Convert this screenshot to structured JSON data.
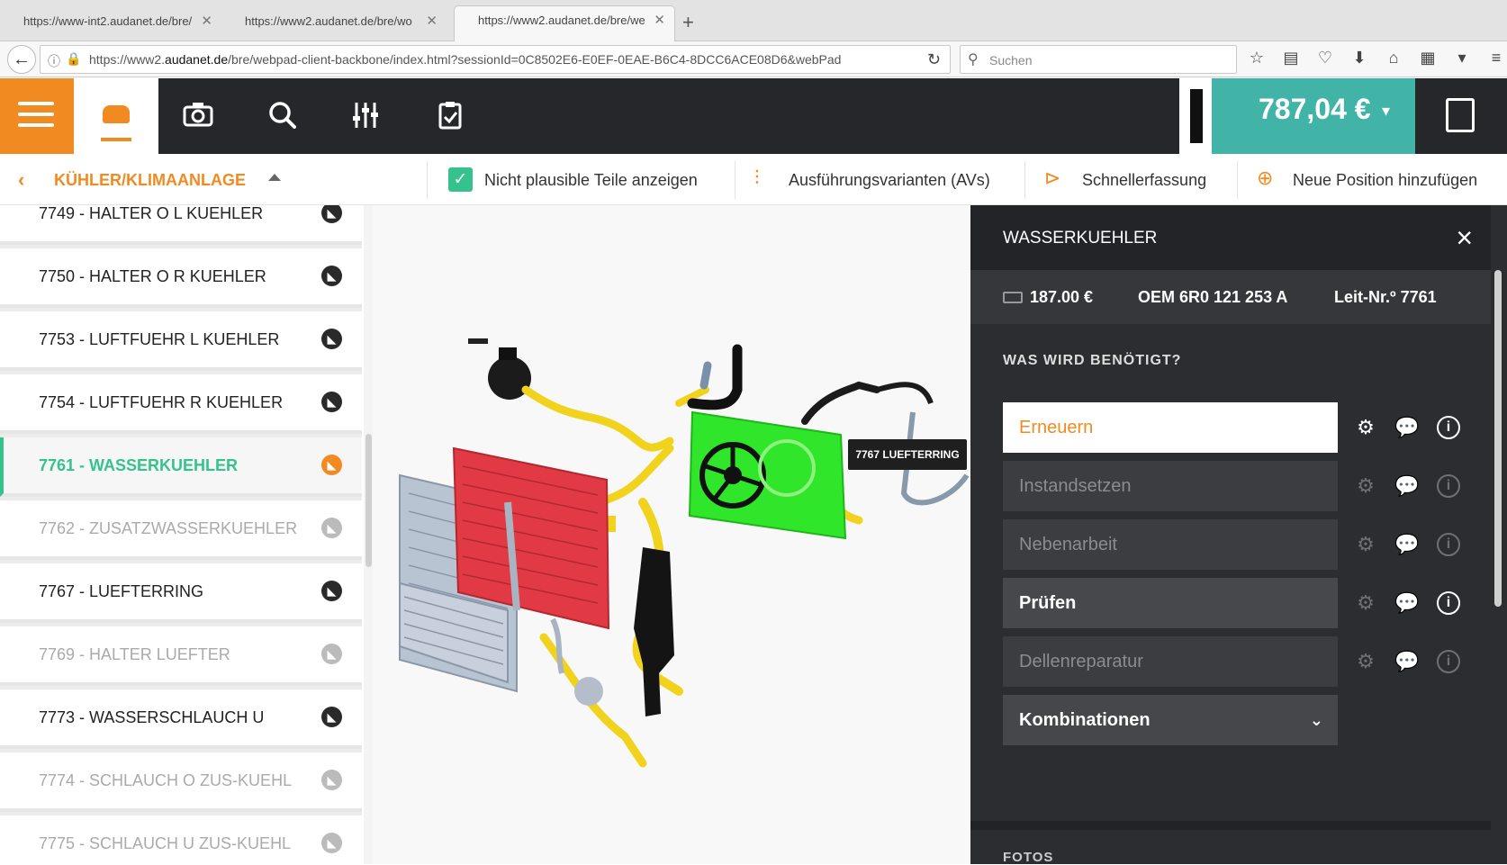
{
  "browser": {
    "tabs": [
      {
        "title": "https://www-int2.audanet.de/bre/"
      },
      {
        "title": "https://www2.audanet.de/bre/wo"
      },
      {
        "title": "https://www2.audanet.de/bre/we"
      }
    ],
    "url_prefix": "https://www2.",
    "url_domain": "audanet.de",
    "url_rest": "/bre/webpad-client-backbone/index.html?sessionId=0C8502E6-E0EF-0EAE-B6C4-8DCC6ACE08D6&webPad",
    "search_placeholder": "Suchen"
  },
  "header": {
    "price": "787,04 €"
  },
  "toolbar": {
    "breadcrumb": "KÜHLER/KLIMAANLAGE",
    "implausible_label": "Nicht plausible Teile anzeigen",
    "variants_label": "Ausführungsvarianten (AVs)",
    "quick_entry_label": "Schnellerfassung",
    "add_position_label": "Neue Position hinzufügen"
  },
  "parts_list": [
    {
      "label": "7749 - HALTER O L KUEHLER",
      "state": "normal"
    },
    {
      "label": "7750 - HALTER O R KUEHLER",
      "state": "normal"
    },
    {
      "label": "7753 - LUFTFUEHR L KUEHLER",
      "state": "normal"
    },
    {
      "label": "7754 - LUFTFUEHR R KUEHLER",
      "state": "normal"
    },
    {
      "label": "7761 - WASSERKUEHLER",
      "state": "active"
    },
    {
      "label": "7762 - ZUSATZWASSERKUEHLER",
      "state": "dim"
    },
    {
      "label": "7767 - LUEFTERRING",
      "state": "normal"
    },
    {
      "label": "7769 - HALTER LUEFTER",
      "state": "dim"
    },
    {
      "label": "7773 - WASSERSCHLAUCH U",
      "state": "normal"
    },
    {
      "label": "7774 - SCHLAUCH O ZUS-KUEHL",
      "state": "dim"
    },
    {
      "label": "7775 - SCHLAUCH U ZUS-KUEHL",
      "state": "dim"
    }
  ],
  "viewer": {
    "tooltip": "7767 LUEFTERRING"
  },
  "panel": {
    "title": "WASSERKUEHLER",
    "price": "187.00 €",
    "oem": "OEM 6R0 121 253 A",
    "leit": "Leit-Nr.º 7761",
    "needed_heading": "WAS WIRD BENÖTIGT?",
    "options": [
      {
        "label": "Erneuern",
        "style": "sel"
      },
      {
        "label": "Instandsetzen",
        "style": "dim"
      },
      {
        "label": "Nebenarbeit",
        "style": "dim"
      },
      {
        "label": "Prüfen",
        "style": "bright"
      },
      {
        "label": "Dellenreparatur",
        "style": "dim"
      }
    ],
    "combinations_label": "Kombinationen",
    "fotos_heading": "FOTOS"
  },
  "colors": {
    "accent_orange": "#f28a22",
    "accent_green": "#35c28d",
    "price_teal": "#41b3a7",
    "dark_bg": "#25272a",
    "radiator_red": "#e23a44",
    "fan_green": "#2fe62a",
    "hose_yellow": "#f1d21d"
  },
  "icons": {
    "menu": "hamburger-icon",
    "vehicle": "car-icon",
    "camera": "camera-icon",
    "search": "search-icon",
    "filters": "sliders-icon",
    "checklist": "clipboard-check-icon",
    "calculator": "calculator-icon"
  }
}
